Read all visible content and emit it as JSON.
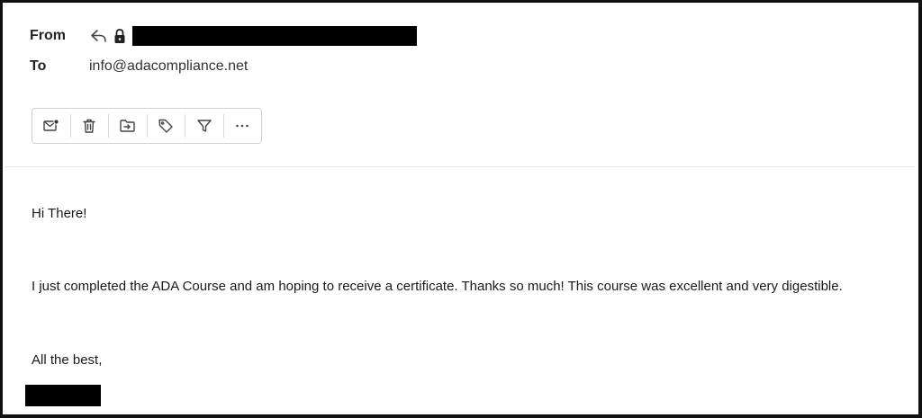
{
  "header": {
    "from_label": "From",
    "to_label": "To",
    "to_value": "info@adacompliance.net"
  },
  "toolbar": {
    "buttons": [
      {
        "icon": "mark-unread-icon"
      },
      {
        "icon": "trash-icon"
      },
      {
        "icon": "move-to-folder-icon"
      },
      {
        "icon": "tag-icon"
      },
      {
        "icon": "filter-icon"
      },
      {
        "icon": "more-horizontal-icon"
      }
    ]
  },
  "message": {
    "greeting": "Hi There!",
    "body": "I just completed the ADA Course and am hoping to receive a certificate. Thanks so much! This course was excellent and very digestible.",
    "closing": "All the best,"
  },
  "colors": {
    "frame": "#111111",
    "redaction": "#000000",
    "toolbar_border": "#d0d0d0",
    "icon": "#444444"
  }
}
